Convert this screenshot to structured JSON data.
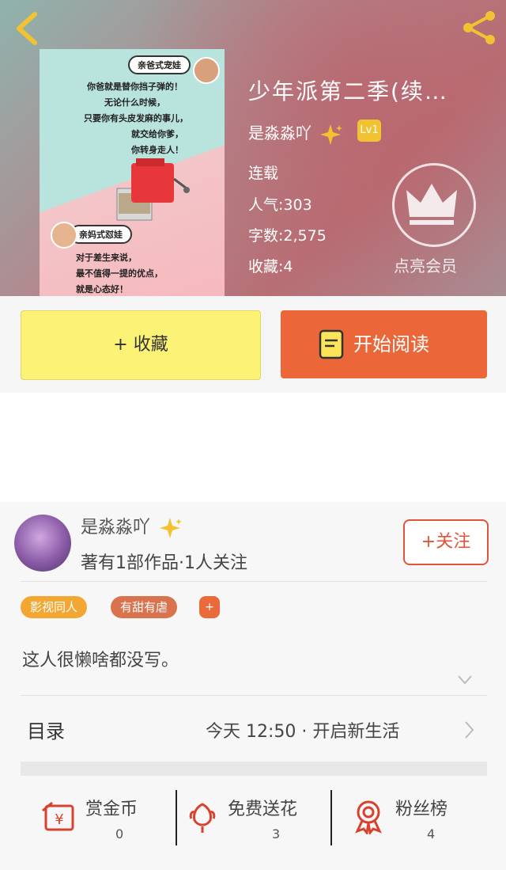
{
  "book": {
    "title": "少年派第二季(续…",
    "author": "是淼淼吖",
    "level": "Lv1",
    "status": "连载",
    "popularity": "人气:303",
    "word_count": "字数:2,575",
    "favorites": "收藏:4",
    "vip_label": "点亮会员"
  },
  "cover": {
    "bubble_top": "亲爸式宠娃",
    "lines_top": [
      "你爸就是替你挡子弹的！",
      "无论什么时候，",
      "只要你有头皮发麻的事儿，",
      "就交给你爹，",
      "你转身走人！"
    ],
    "bubble_bottom": "亲妈式怼娃",
    "lines_bottom": [
      "对于差生来说，",
      "最不值得一提的优点，",
      "就是心态好！"
    ]
  },
  "actions": {
    "favorite": "+ 收藏",
    "read": "开始阅读"
  },
  "profile": {
    "name": "是淼淼吖",
    "stats": "著有1部作品·1人关注",
    "follow": "+关注",
    "tags": [
      "影视同人",
      "有甜有虐"
    ],
    "tag_add": "+",
    "intro": "这人很懒啥都没写。"
  },
  "toc": {
    "label": "目录",
    "latest": "今天 12:50 · 开启新生活"
  },
  "stats": [
    {
      "label": "赏金币",
      "value": "0"
    },
    {
      "label": "免费送花",
      "value": "3"
    },
    {
      "label": "粉丝榜",
      "value": "4"
    }
  ],
  "colors": {
    "accent_orange": "#eb6739",
    "favorite_yellow": "#fbf276",
    "level_gold": "#f1c232",
    "tag_orange": "#f3a733",
    "tag_red": "#d9734e",
    "icon_red": "#d9412f"
  },
  "icons": [
    "back-icon",
    "share-icon",
    "crown-icon",
    "sparkle-icon",
    "book-icon",
    "chevron-down-icon",
    "chevron-right-icon",
    "coin-icon",
    "flower-icon",
    "medal-icon"
  ]
}
